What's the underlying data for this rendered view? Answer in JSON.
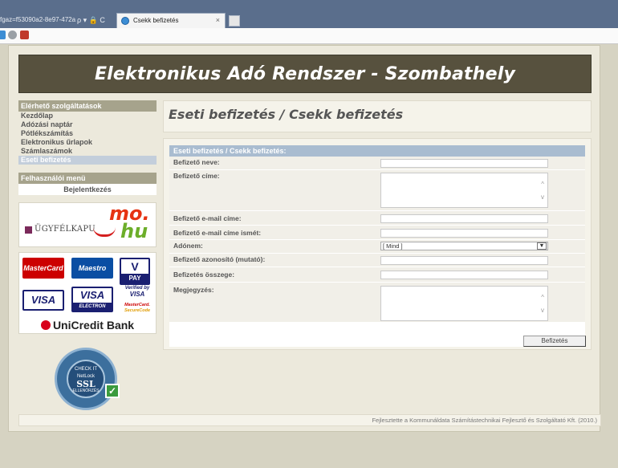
{
  "browser": {
    "address_fragment": "fgaz=f53090a2-8e97-472a",
    "address_icons": "ρ ▾ 🔒 C",
    "tab_title": "Csekk befizetés",
    "tab_close": "×"
  },
  "banner": {
    "title": "Elektronikus Adó Rendszer - Szombathely"
  },
  "sidebar": {
    "services_heading": "Elérhető szolgáltatások",
    "items": [
      {
        "label": "Kezdőlap"
      },
      {
        "label": "Adózási naptár"
      },
      {
        "label": "Pótlékszámítás"
      },
      {
        "label": "Elektronikus űrlapok"
      },
      {
        "label": "Számlaszámok"
      },
      {
        "label": "Eseti befizetés"
      }
    ],
    "user_menu_heading": "Felhasználói menü",
    "login_label": "Bejelentkezés",
    "ugyfelkapu_label": "ÜGYFÉLKAPU",
    "mohu_top": "mo.",
    "mohu_bottom": "hu",
    "cards": {
      "mastercard": "MasterCard",
      "maestro": "Maestro",
      "vpay_v": "V",
      "vpay_pay": "PAY",
      "visa": "VISA",
      "visa_electron": "VISA",
      "electron": "ELECTRON",
      "verified_by": "Verified by",
      "verified_visa": "VISA",
      "securecode_mc": "MasterCard.",
      "securecode": "SecureCode"
    },
    "bank": "UniCredit Bank",
    "ssl": {
      "check_it": "CHECK IT",
      "netlock": "NetLock",
      "ssl": "SSL",
      "ellenorzes": "ELLENŐRZÉS"
    }
  },
  "main": {
    "title": "Eseti befizetés / Csekk befizetés",
    "form_heading": "Eseti befizetés / Csekk befizetés:",
    "fields": {
      "payer_name": {
        "label": "Befizető neve:",
        "value": ""
      },
      "payer_address": {
        "label": "Befizető címe:",
        "value": ""
      },
      "payer_email": {
        "label": "Befizető e-mail címe:",
        "value": ""
      },
      "payer_email_repeat": {
        "label": "Befizető e-mail címe ismét:",
        "value": ""
      },
      "tax_type": {
        "label": "Adónem:",
        "selected": "[ Mind ]"
      },
      "payer_id": {
        "label": "Befizető azonosító (mutató):",
        "value": ""
      },
      "amount": {
        "label": "Befizetés összege:",
        "value": ""
      },
      "note": {
        "label": "Megjegyzés:",
        "value": ""
      }
    },
    "submit_label": "Befizetés"
  },
  "footer": {
    "text": "Fejlesztette a Kommunáldata Számítástechnikai Fejlesztő és Szolgáltató Kft. (2010.)"
  },
  "colors": {
    "banner": "#57513e",
    "sidebar_heading": "#a6a38c",
    "form_heading": "#a9bcd0",
    "active_nav": "#c3cedb"
  }
}
